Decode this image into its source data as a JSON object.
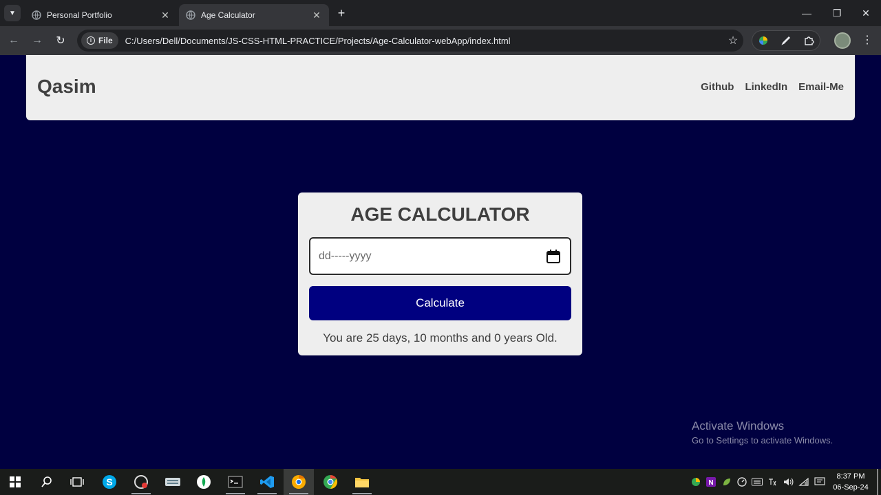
{
  "browser": {
    "tabs": [
      {
        "title": "Personal Portfolio",
        "active": false
      },
      {
        "title": "Age Calculator",
        "active": true
      }
    ],
    "address": {
      "scheme_label": "File",
      "url": "C:/Users/Dell/Documents/JS-CSS-HTML-PRACTICE/Projects/Age-Calculator-webApp/index.html"
    }
  },
  "page": {
    "brand": "Qasim",
    "nav_links": [
      "Github",
      "LinkedIn",
      "Email-Me"
    ],
    "card": {
      "title": "AGE CALCULATOR",
      "date_placeholder": "dd-----yyyy",
      "button_label": "Calculate",
      "result": "You are 25 days, 10 months and 0 years Old."
    }
  },
  "watermark": {
    "line1": "Activate Windows",
    "line2": "Go to Settings to activate Windows."
  },
  "taskbar": {
    "clock_time": "8:37 PM",
    "clock_date": "06-Sep-24"
  },
  "colors": {
    "page_background": "#000040",
    "button_background": "#000080",
    "navbar_background": "#eeeeee"
  }
}
